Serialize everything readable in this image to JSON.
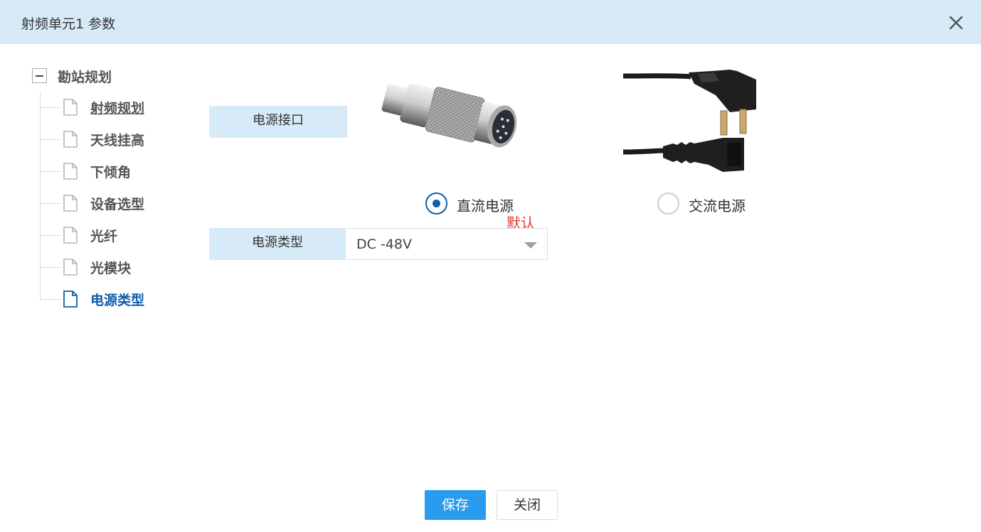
{
  "window": {
    "title": "射频单元1 参数"
  },
  "tree": {
    "root_label": "勘站规划",
    "items": [
      {
        "label": "射频规划"
      },
      {
        "label": "天线挂高"
      },
      {
        "label": "下倾角"
      },
      {
        "label": "设备选型"
      },
      {
        "label": "光纤"
      },
      {
        "label": "光模块"
      },
      {
        "label": "电源类型"
      }
    ],
    "active_item": "电源类型"
  },
  "power_interface": {
    "label": "电源接口",
    "options": [
      {
        "label": "直流电源",
        "checked": true,
        "note": "默认",
        "image_icon": "dc-connector-icon"
      },
      {
        "label": "交流电源",
        "checked": false,
        "image_icon": "ac-power-cord-icon"
      }
    ]
  },
  "power_type": {
    "label": "电源类型",
    "value": "DC -48V"
  },
  "footer": {
    "save_label": "保存",
    "close_label": "关闭"
  },
  "colors": {
    "header_bg": "#d7eaf8",
    "accent": "#0e5ea8",
    "primary_button": "#2a9cf0",
    "note_red": "#e53935"
  }
}
